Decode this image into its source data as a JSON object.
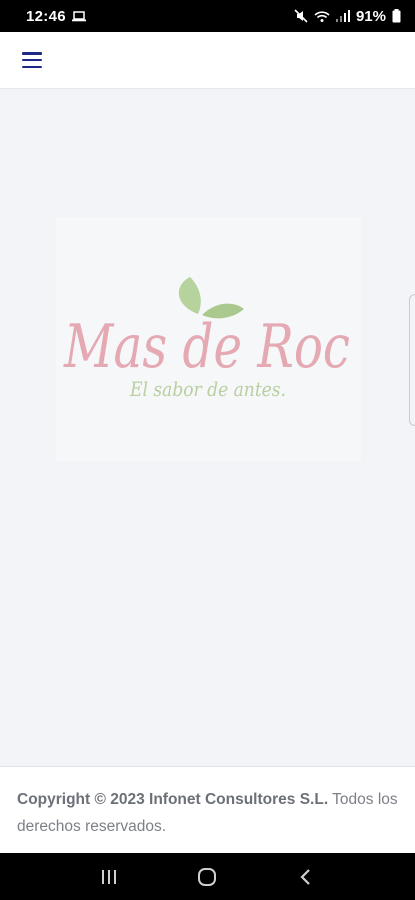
{
  "status_bar": {
    "time": "12:46",
    "battery": "91%",
    "icons": [
      "laptop-icon",
      "mute-icon",
      "wifi-icon",
      "signal-icon",
      "battery-icon"
    ]
  },
  "header": {
    "menu_icon": "hamburger-menu-icon",
    "accent_color": "#1d2a85"
  },
  "logo": {
    "brand_text": "Mas de Roc",
    "tagline": "El sabor de antes.",
    "brand_color": "#e4a9b3",
    "leaf_color": "#a9c98f"
  },
  "footer": {
    "copyright_bold": "Copyright © 2023 Infonet Consultores S.L.",
    "copyright_rest": "Todos los derechos reservados."
  },
  "nav_bar": {
    "buttons": [
      "recents-icon",
      "home-icon",
      "back-icon"
    ]
  }
}
